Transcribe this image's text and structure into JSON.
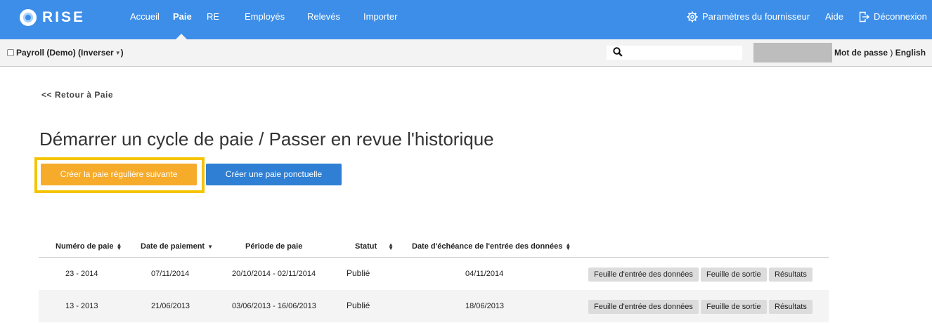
{
  "brand": {
    "name": "RISE"
  },
  "nav": {
    "items": [
      {
        "label": "Accueil",
        "active": false
      },
      {
        "label": "Paie",
        "active": true
      },
      {
        "label": "RE",
        "active": false
      },
      {
        "label": "Employés",
        "active": false
      },
      {
        "label": "Relevés",
        "active": false
      },
      {
        "label": "Importer",
        "active": false
      }
    ],
    "settings_label": "Paramètres du fournisseur",
    "help_label": "Aide",
    "logout_label": "Déconnexion"
  },
  "subbar": {
    "company": "Payroll (Demo)",
    "switch_label": "(Inverser",
    "switch_close": ")",
    "password_label": "Mot de passe",
    "paren": ")",
    "language_label": "English",
    "search_placeholder": ""
  },
  "main": {
    "back_link": "<< Retour à Paie",
    "title": "Démarrer un cycle de paie / Passer en revue l'historique",
    "btn_regular": "Créer la paie régulière suivante",
    "btn_oneoff": "Créer une paie ponctuelle"
  },
  "table": {
    "headers": {
      "pay_number": "Numéro de paie",
      "pay_date": "Date de paiement",
      "period": "Période de paie",
      "status": "Statut",
      "due_date": "Date d'échéance de l'entrée des données"
    },
    "rows": [
      {
        "pay_number": "23 - 2014",
        "pay_date": "07/11/2014",
        "period": "20/10/2014 - 02/11/2014",
        "status": "Publié",
        "due_date": "04/11/2014"
      },
      {
        "pay_number": "13 - 2013",
        "pay_date": "21/06/2013",
        "period": "03/06/2013 - 16/06/2013",
        "status": "Publié",
        "due_date": "18/06/2013"
      }
    ],
    "actions": {
      "input_sheet": "Feuille d'entrée des données",
      "output_sheet": "Feuille de sortie",
      "results": "Résultats"
    }
  },
  "colors": {
    "nav_bg": "#3d8ee8",
    "orange_button": "#f6ab2a",
    "blue_button": "#2f7fd4",
    "highlight": "#f5c400"
  }
}
